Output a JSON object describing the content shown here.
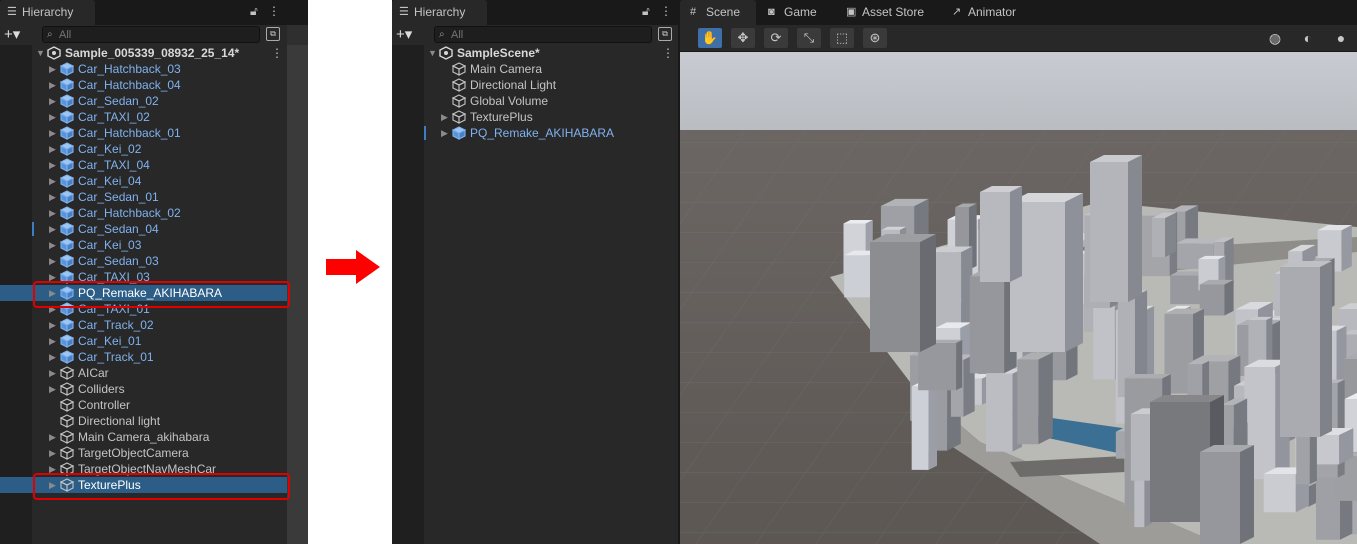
{
  "left": {
    "tab_title": "Hierarchy",
    "search_placeholder": "All",
    "scene_name": "Sample_005339_08932_25_14*",
    "items": [
      {
        "label": "Car_Hatchback_03",
        "kind": "prefab",
        "expandable": true
      },
      {
        "label": "Car_Hatchback_04",
        "kind": "prefab",
        "expandable": true
      },
      {
        "label": "Car_Sedan_02",
        "kind": "prefab",
        "expandable": true
      },
      {
        "label": "Car_TAXI_02",
        "kind": "prefab",
        "expandable": true
      },
      {
        "label": "Car_Hatchback_01",
        "kind": "prefab",
        "expandable": true
      },
      {
        "label": "Car_Kei_02",
        "kind": "prefab",
        "expandable": true
      },
      {
        "label": "Car_TAXI_04",
        "kind": "prefab",
        "expandable": true
      },
      {
        "label": "Car_Kei_04",
        "kind": "prefab",
        "expandable": true
      },
      {
        "label": "Car_Sedan_01",
        "kind": "prefab",
        "expandable": true
      },
      {
        "label": "Car_Hatchback_02",
        "kind": "prefab",
        "expandable": true
      },
      {
        "label": "Car_Sedan_04",
        "kind": "prefab",
        "expandable": true
      },
      {
        "label": "Car_Kei_03",
        "kind": "prefab",
        "expandable": true
      },
      {
        "label": "Car_Sedan_03",
        "kind": "prefab",
        "expandable": true
      },
      {
        "label": "Car_TAXI_03",
        "kind": "prefab",
        "expandable": true
      },
      {
        "label": "PQ_Remake_AKIHABARA",
        "kind": "prefab",
        "expandable": true,
        "selected": true
      },
      {
        "label": "Car_TAXI_01",
        "kind": "prefab",
        "expandable": true
      },
      {
        "label": "Car_Track_02",
        "kind": "prefab",
        "expandable": true
      },
      {
        "label": "Car_Kei_01",
        "kind": "prefab",
        "expandable": true
      },
      {
        "label": "Car_Track_01",
        "kind": "prefab",
        "expandable": true
      },
      {
        "label": "AICar",
        "kind": "plain",
        "expandable": true
      },
      {
        "label": "Colliders",
        "kind": "plain",
        "expandable": true
      },
      {
        "label": "Controller",
        "kind": "plain",
        "expandable": false
      },
      {
        "label": "Directional light",
        "kind": "plain",
        "expandable": false
      },
      {
        "label": "Main Camera_akihabara",
        "kind": "plain",
        "expandable": true
      },
      {
        "label": "TargetObjectCamera",
        "kind": "plain",
        "expandable": true
      },
      {
        "label": "TargetObjectNavMeshCar",
        "kind": "plain",
        "expandable": true
      },
      {
        "label": "TexturePlus",
        "kind": "plain",
        "expandable": true,
        "selected": true
      }
    ]
  },
  "right": {
    "tab_title": "Hierarchy",
    "search_placeholder": "All",
    "scene_name": "SampleScene*",
    "items": [
      {
        "label": "Main Camera",
        "kind": "plain",
        "expandable": false
      },
      {
        "label": "Directional Light",
        "kind": "plain",
        "expandable": false
      },
      {
        "label": "Global Volume",
        "kind": "plain",
        "expandable": false
      },
      {
        "label": "TexturePlus",
        "kind": "plain",
        "expandable": true
      },
      {
        "label": "PQ_Remake_AKIHABARA",
        "kind": "prefab",
        "expandable": true
      }
    ],
    "scene_tabs": [
      {
        "label": "Scene",
        "icon": "grid-icon",
        "glyph": "#",
        "active": true
      },
      {
        "label": "Game",
        "icon": "gamepad-icon",
        "glyph": "◙",
        "active": false
      },
      {
        "label": "Asset Store",
        "icon": "shopping-bag-icon",
        "glyph": "▣",
        "active": false
      },
      {
        "label": "Animator",
        "icon": "animator-icon",
        "glyph": "↗",
        "active": false
      }
    ],
    "tools": [
      {
        "name": "hand-tool-icon",
        "glyph": "✋",
        "active": true
      },
      {
        "name": "move-tool-icon",
        "glyph": "✥",
        "active": false
      },
      {
        "name": "rotate-tool-icon",
        "glyph": "⟳",
        "active": false
      },
      {
        "name": "scale-tool-icon",
        "glyph": "⤡",
        "active": false
      },
      {
        "name": "rect-tool-icon",
        "glyph": "⬚",
        "active": false
      },
      {
        "name": "transform-tool-icon",
        "glyph": "⊛",
        "active": false
      }
    ],
    "shading": [
      {
        "name": "wireframe-shading-icon",
        "glyph": "◍"
      },
      {
        "name": "shaded-shading-icon",
        "glyph": "◐"
      },
      {
        "name": "lit-shading-icon",
        "glyph": "●"
      }
    ]
  },
  "colors": {
    "prefab_text": "#7fb2ef",
    "selection": "#2c5d87",
    "highlight_box": "#e00000",
    "arrow": "#ff0000"
  }
}
